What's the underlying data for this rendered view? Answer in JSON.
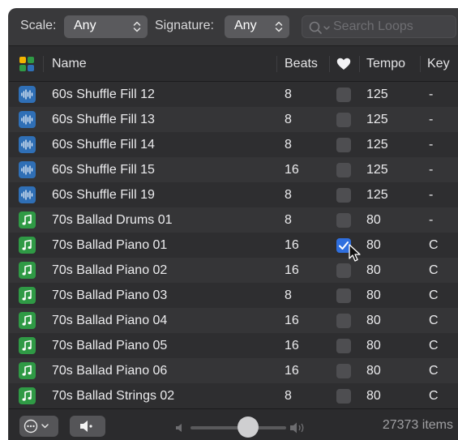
{
  "filters": {
    "scale_label": "Scale:",
    "scale_value": "Any",
    "signature_label": "Signature:",
    "signature_value": "Any",
    "search_placeholder": "Search Loops"
  },
  "columns": {
    "name": "Name",
    "beats": "Beats",
    "favorite_icon": "heart-icon",
    "tempo": "Tempo",
    "key": "Key"
  },
  "rows": [
    {
      "type": "audio",
      "name": "60s Shuffle Fill 12",
      "beats": "8",
      "favorite": false,
      "tempo": "125",
      "key": "-"
    },
    {
      "type": "audio",
      "name": "60s Shuffle Fill 13",
      "beats": "8",
      "favorite": false,
      "tempo": "125",
      "key": "-"
    },
    {
      "type": "audio",
      "name": "60s Shuffle Fill 14",
      "beats": "8",
      "favorite": false,
      "tempo": "125",
      "key": "-"
    },
    {
      "type": "audio",
      "name": "60s Shuffle Fill 15",
      "beats": "16",
      "favorite": false,
      "tempo": "125",
      "key": "-"
    },
    {
      "type": "audio",
      "name": "60s Shuffle Fill 19",
      "beats": "8",
      "favorite": false,
      "tempo": "125",
      "key": "-"
    },
    {
      "type": "midi",
      "name": "70s Ballad Drums 01",
      "beats": "8",
      "favorite": false,
      "tempo": "80",
      "key": "-"
    },
    {
      "type": "midi",
      "name": "70s Ballad Piano 01",
      "beats": "16",
      "favorite": true,
      "tempo": "80",
      "key": "C"
    },
    {
      "type": "midi",
      "name": "70s Ballad Piano 02",
      "beats": "16",
      "favorite": false,
      "tempo": "80",
      "key": "C"
    },
    {
      "type": "midi",
      "name": "70s Ballad Piano 03",
      "beats": "8",
      "favorite": false,
      "tempo": "80",
      "key": "C"
    },
    {
      "type": "midi",
      "name": "70s Ballad Piano 04",
      "beats": "16",
      "favorite": false,
      "tempo": "80",
      "key": "C"
    },
    {
      "type": "midi",
      "name": "70s Ballad Piano 05",
      "beats": "16",
      "favorite": false,
      "tempo": "80",
      "key": "C"
    },
    {
      "type": "midi",
      "name": "70s Ballad Piano 06",
      "beats": "16",
      "favorite": false,
      "tempo": "80",
      "key": "C"
    },
    {
      "type": "midi",
      "name": "70s Ballad Strings 02",
      "beats": "8",
      "favorite": false,
      "tempo": "80",
      "key": "C"
    }
  ],
  "footer": {
    "volume_level": 0.6,
    "item_count": "27373 items"
  },
  "colors": {
    "audio_loop": "#2f6fb6",
    "midi_loop": "#2f9a45",
    "checkbox_checked": "#2f6fdf"
  }
}
